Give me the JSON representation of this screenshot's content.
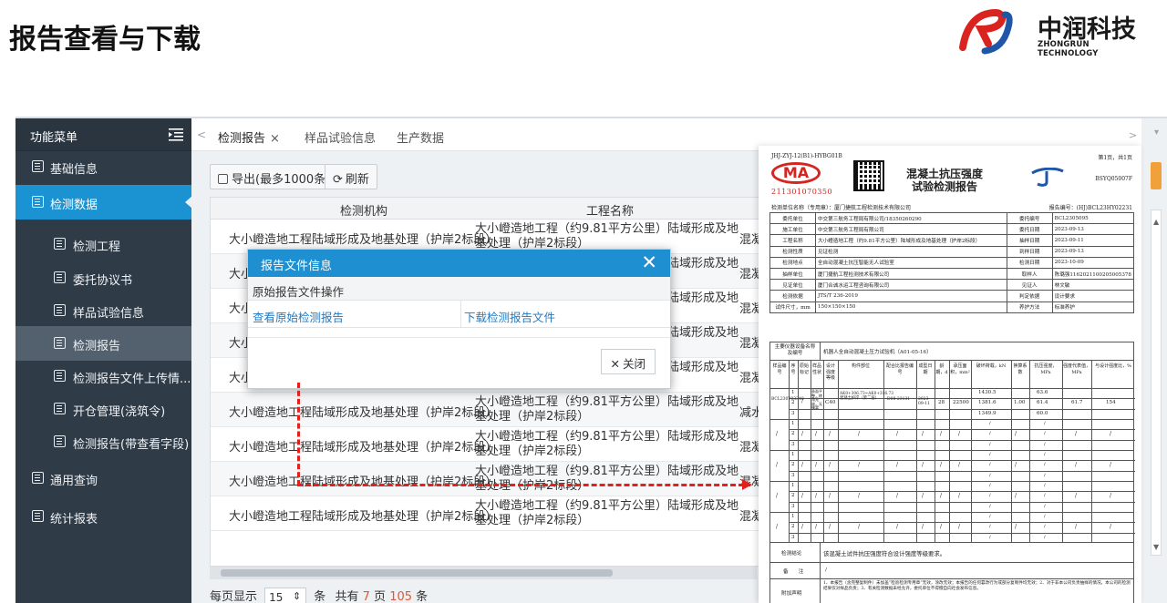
{
  "slide": {
    "title": "报告查看与下载"
  },
  "logo": {
    "name_cn": "中润科技",
    "name_en": "ZHONGRUN TECHNOLOGY",
    "mark": "RJ",
    "colors": {
      "red": "#d8231f",
      "blue": "#1f56a8"
    }
  },
  "sidebar": {
    "header": "功能菜单",
    "items": [
      {
        "label": "基础信息",
        "level": 1
      },
      {
        "label": "检测数据",
        "level": 1,
        "state": "active"
      },
      {
        "label": "检测工程",
        "level": 2
      },
      {
        "label": "委托协议书",
        "level": 2
      },
      {
        "label": "样品试验信息",
        "level": 2
      },
      {
        "label": "检测报告",
        "level": 2,
        "state": "selected"
      },
      {
        "label": "检测报告文件上传情...",
        "level": 2
      },
      {
        "label": "开仓管理(浇筑令)",
        "level": 2
      },
      {
        "label": "检测报告(带查看字段)",
        "level": 2
      },
      {
        "label": "通用查询",
        "level": 1
      },
      {
        "label": "统计报表",
        "level": 1
      }
    ]
  },
  "tabs": {
    "left_arrow": "<",
    "right_arrow": ">",
    "dropdown": "▾",
    "items": [
      {
        "label": "检测报告",
        "close": "×",
        "active": true
      },
      {
        "label": "样品试验信息"
      },
      {
        "label": "生产数据"
      }
    ]
  },
  "toolbar": {
    "export": "导出(最多1000条)",
    "refresh": "刷新"
  },
  "table": {
    "headers": [
      "检测机构",
      "工程名称"
    ],
    "rows": [
      {
        "org": "大小嶝造地工程陆域形成及地基处理（护岸2标段）",
        "project": "大小嶝造地工程（约9.81平方公里）陆域形成及地基处理（护岸2标段）",
        "extra": "混凝"
      },
      {
        "org": "大小嶝",
        "project": "大小嶝造地工程（约9.81平方公里）陆域形成及地基处理（护岸2标段）",
        "extra": "混凝"
      },
      {
        "org": "大小嶝",
        "project": "大小嶝造地工程（约9.81平方公里）陆域形成及地基处理（护岸2标段）",
        "extra": "混凝"
      },
      {
        "org": "大小嶝",
        "project": "大小嶝造地工程（约9.81平方公里）陆域形成及地基处理（护岸2标段）",
        "extra": "混凝"
      },
      {
        "org": "大小嶝造地工程陆域形成及地基处理（护岸2标段）",
        "project": "大小嶝造地工程（约9.81平方公里）陆域形成及地基处理（护岸2标段）",
        "extra": "混凝"
      },
      {
        "org": "大小嶝造地工程陆域形成及地基处理（护岸2标段）",
        "project": "大小嶝造地工程（约9.81平方公里）陆域形成及地基处理（护岸2标段）",
        "extra": "减水"
      },
      {
        "org": "大小嶝造地工程陆域形成及地基处理（护岸2标段）",
        "project": "大小嶝造地工程（约9.81平方公里）陆域形成及地基处理（护岸2标段）",
        "extra": "混凝"
      },
      {
        "org": "大小嶝造地工程陆域形成及地基处理（护岸2标段）",
        "project": "大小嶝造地工程（约9.81平方公里）陆域形成及地基处理（护岸2标段）",
        "extra": "混凝"
      },
      {
        "org": "大小嶝造地工程陆域形成及地基处理（护岸2标段）",
        "project": "大小嶝造地工程（约9.81平方公里）陆域形成及地基处理（护岸2标段）",
        "extra": "混凝"
      }
    ]
  },
  "pager": {
    "prefix": "每页显示",
    "page_size": "15",
    "unit": "条",
    "total_label_1": "共有",
    "pages": "7",
    "page_label": "页",
    "records": "105",
    "record_label": "条"
  },
  "modal": {
    "title": "报告文件信息",
    "close_icon": "✕",
    "section": "原始报告文件操作",
    "view_link": "查看原始检测报告",
    "download_link": "下载检测报告文件",
    "close_button": "关闭"
  },
  "report": {
    "doc_code": "JHJ-ZYJ-12(B1)-HYBG01B",
    "page_info": "第1页，共1页",
    "ma_label": "MA",
    "ma_number": "211301070350",
    "title_line1": "混凝土抗压强度",
    "title_line2": "试验检测报告",
    "report_no_code": "BSYQ05007F",
    "org_line": "检测单位名称（专用章）：厦门捷航工程检测技术有限公司",
    "report_no": "报告编号：(HJ)BCL23HY02231",
    "fields": [
      [
        "委托单位",
        "中交第三航务工程局有限公司/18350260290",
        "委托编号",
        "BCL2305095"
      ],
      [
        "施工单位",
        "中交第三航务工程局有限公司",
        "委托日期",
        "2023-09-13"
      ],
      [
        "工程名称",
        "大小嶝造地工程（约9.81平方公里）陆域形成及地基处理（护岸2标段）",
        "抽样日期",
        "2023-09-11"
      ],
      [
        "检测性质",
        "见证检测",
        "到样日期",
        "2023-09-13"
      ],
      [
        "检测地点",
        "全自动混凝土抗压智能无人试验室",
        "检测日期",
        "2023-10-09"
      ],
      [
        "抽样单位",
        "厦门捷航工程检测技术有限公司",
        "取样人",
        "陈璐强1162021100205005378"
      ],
      [
        "见证单位",
        "厦门合诚水运工程咨询有限公司",
        "见证人",
        "林文敏"
      ],
      [
        "检测依据",
        "JTS/T 236-2019",
        "判定依据",
        "设计要求"
      ],
      [
        "试件尺寸，mm",
        "150×150×150",
        "养护方法",
        "标准养护"
      ]
    ],
    "equip_label": "主要仪器设备名称及编号",
    "equip_value": "机器人全自动混凝土压力试验机（A01-05-16）",
    "col_headers": [
      "样品编号",
      "序号",
      "原始标记",
      "样品性状",
      "设计强度等级",
      "构件部位",
      "配合比报告编号",
      "成型日期",
      "龄期，d",
      "承压面积，mm²",
      "破坏荷载，kN",
      "换算系数",
      "抗压强度，MPa",
      "强度代表值，MPa",
      "与设计强度比，%"
    ],
    "sample": {
      "id": "BCL230Y03348",
      "state": "表面平整，棱角无缺，无蜂窝",
      "grade": "C40",
      "part": "AK0+306.73~AK0+316.73混凝土护岸（第二层）",
      "mix": "D08-23131",
      "date": "2023-09-11",
      "age": "28",
      "area": "22500",
      "loads": [
        "1430.5",
        "1381.6",
        "1349.9"
      ],
      "factor": "1.00",
      "strengths": [
        "63.6",
        "61.4",
        "60.0"
      ],
      "rep": "61.7",
      "ratio": "154"
    },
    "conclusion_label": "检测结论",
    "conclusion": "该混凝土试件抗压强度符合设计强度等级要求。",
    "remark_label": "备　　注",
    "remark": "/",
    "notice_label": "附加声明",
    "notice": "1、本报告（含完整复制件）未加盖“检验检测专用章”无效，涂改无效；本报告的任何篡改行为或部分复制件均无效；2、对于非本公司负责抽样的情况，本公司的检测结果仅对样品负责；3、有关检测数据未经允许，委托单位不得擅自向社会发布信息。",
    "slash": "/"
  }
}
